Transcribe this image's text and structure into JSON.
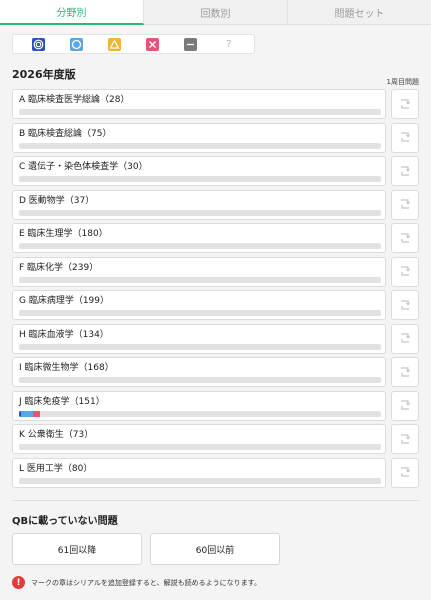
{
  "tabs": [
    {
      "label": "分野別",
      "active": true
    },
    {
      "label": "回数別",
      "active": false
    },
    {
      "label": "問題セット",
      "active": false
    }
  ],
  "marks": [
    {
      "icon": "double-circle-icon"
    },
    {
      "icon": "circle-icon"
    },
    {
      "icon": "triangle-icon"
    },
    {
      "icon": "cross-icon"
    },
    {
      "icon": "dash-icon"
    },
    {
      "icon": "question-mark-icon",
      "label": "?"
    }
  ],
  "section": {
    "title": "2026年度版",
    "column_label": "1周目問題"
  },
  "subjects": [
    {
      "label": "A 臨床検査医学総論（28）",
      "progress": []
    },
    {
      "label": "B 臨床検査総論（75）",
      "progress": []
    },
    {
      "label": "C 遺伝子・染色体検査学（30）",
      "progress": []
    },
    {
      "label": "D 医動物学（37）",
      "progress": []
    },
    {
      "label": "E 臨床生理学（180）",
      "progress": []
    },
    {
      "label": "F 臨床化学（239）",
      "progress": []
    },
    {
      "label": "G 臨床病理学（199）",
      "progress": []
    },
    {
      "label": "H 臨床血液学（134）",
      "progress": []
    },
    {
      "label": "I 臨床微生物学（168）",
      "progress": []
    },
    {
      "label": "J 臨床免疫学（151）",
      "progress": [
        {
          "status": "double-circle",
          "fraction": 0.006,
          "color": "#2a4fbf"
        },
        {
          "status": "circle",
          "fraction": 0.033,
          "color": "#59a7e6"
        },
        {
          "status": "cross",
          "fraction": 0.02,
          "color": "#e8537a"
        }
      ]
    },
    {
      "label": "K 公衆衛生（73）",
      "progress": []
    },
    {
      "label": "L 医用工学（80）",
      "progress": []
    }
  ],
  "qb_section": {
    "title": "QBに載っていない問題",
    "buttons": [
      "61回以降",
      "60回以前"
    ]
  },
  "notice": {
    "icon_label": "!",
    "text": "マークの章はシリアルを追加登録すると、解説も読めるようになります。"
  },
  "colors": {
    "accent": "#2fb57a",
    "double_circle": "#2a4fbf",
    "circle": "#59a7e6",
    "triangle": "#f3b23a",
    "cross": "#e8537a",
    "dash": "#7a7a7a",
    "alert": "#e03c3c"
  }
}
